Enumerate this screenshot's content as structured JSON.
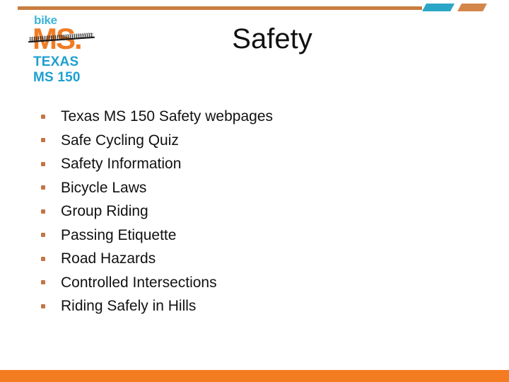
{
  "slide": {
    "title": "Safety",
    "background_color": "#FFFFFF"
  },
  "decoration": {
    "top_line_color": "#C87D3F",
    "top_slash_blue_color": "#2CA6C6",
    "top_slash_orange_color": "#D4864A",
    "bottom_bar_color": "#F47C20"
  },
  "logo": {
    "bike_text": "bike",
    "ms_text": "MS.",
    "texas_text": "TEXAS",
    "ms150_text": "MS 150",
    "blue_color": "#1E9FD0",
    "orange_color": "#EE7C26"
  },
  "content": {
    "bullets": [
      {
        "label": "Texas MS 150 Safety webpages"
      },
      {
        "label": "Safe Cycling Quiz"
      },
      {
        "label": "Safety Information"
      },
      {
        "label": "Bicycle Laws"
      },
      {
        "label": "Group Riding"
      },
      {
        "label": "Passing Etiquette"
      },
      {
        "label": "Road Hazards"
      },
      {
        "label": "Controlled Intersections"
      },
      {
        "label": "Riding Safely in Hills"
      }
    ],
    "bullet_marker_color": "#C1764A"
  }
}
